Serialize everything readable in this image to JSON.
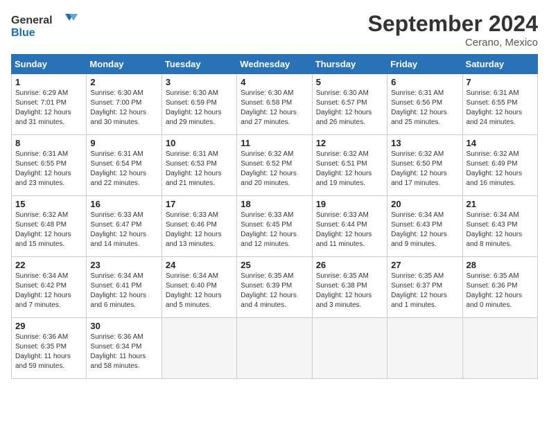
{
  "header": {
    "logo_general": "General",
    "logo_blue": "Blue",
    "title": "September 2024",
    "location": "Cerano, Mexico"
  },
  "weekdays": [
    "Sunday",
    "Monday",
    "Tuesday",
    "Wednesday",
    "Thursday",
    "Friday",
    "Saturday"
  ],
  "weeks": [
    [
      {
        "day": "1",
        "sunrise": "6:29 AM",
        "sunset": "7:01 PM",
        "daylight": "12 hours and 31 minutes."
      },
      {
        "day": "2",
        "sunrise": "6:30 AM",
        "sunset": "7:00 PM",
        "daylight": "12 hours and 30 minutes."
      },
      {
        "day": "3",
        "sunrise": "6:30 AM",
        "sunset": "6:59 PM",
        "daylight": "12 hours and 29 minutes."
      },
      {
        "day": "4",
        "sunrise": "6:30 AM",
        "sunset": "6:58 PM",
        "daylight": "12 hours and 27 minutes."
      },
      {
        "day": "5",
        "sunrise": "6:30 AM",
        "sunset": "6:57 PM",
        "daylight": "12 hours and 26 minutes."
      },
      {
        "day": "6",
        "sunrise": "6:31 AM",
        "sunset": "6:56 PM",
        "daylight": "12 hours and 25 minutes."
      },
      {
        "day": "7",
        "sunrise": "6:31 AM",
        "sunset": "6:55 PM",
        "daylight": "12 hours and 24 minutes."
      }
    ],
    [
      {
        "day": "8",
        "sunrise": "6:31 AM",
        "sunset": "6:55 PM",
        "daylight": "12 hours and 23 minutes."
      },
      {
        "day": "9",
        "sunrise": "6:31 AM",
        "sunset": "6:54 PM",
        "daylight": "12 hours and 22 minutes."
      },
      {
        "day": "10",
        "sunrise": "6:31 AM",
        "sunset": "6:53 PM",
        "daylight": "12 hours and 21 minutes."
      },
      {
        "day": "11",
        "sunrise": "6:32 AM",
        "sunset": "6:52 PM",
        "daylight": "12 hours and 20 minutes."
      },
      {
        "day": "12",
        "sunrise": "6:32 AM",
        "sunset": "6:51 PM",
        "daylight": "12 hours and 19 minutes."
      },
      {
        "day": "13",
        "sunrise": "6:32 AM",
        "sunset": "6:50 PM",
        "daylight": "12 hours and 17 minutes."
      },
      {
        "day": "14",
        "sunrise": "6:32 AM",
        "sunset": "6:49 PM",
        "daylight": "12 hours and 16 minutes."
      }
    ],
    [
      {
        "day": "15",
        "sunrise": "6:32 AM",
        "sunset": "6:48 PM",
        "daylight": "12 hours and 15 minutes."
      },
      {
        "day": "16",
        "sunrise": "6:33 AM",
        "sunset": "6:47 PM",
        "daylight": "12 hours and 14 minutes."
      },
      {
        "day": "17",
        "sunrise": "6:33 AM",
        "sunset": "6:46 PM",
        "daylight": "12 hours and 13 minutes."
      },
      {
        "day": "18",
        "sunrise": "6:33 AM",
        "sunset": "6:45 PM",
        "daylight": "12 hours and 12 minutes."
      },
      {
        "day": "19",
        "sunrise": "6:33 AM",
        "sunset": "6:44 PM",
        "daylight": "12 hours and 11 minutes."
      },
      {
        "day": "20",
        "sunrise": "6:34 AM",
        "sunset": "6:43 PM",
        "daylight": "12 hours and 9 minutes."
      },
      {
        "day": "21",
        "sunrise": "6:34 AM",
        "sunset": "6:43 PM",
        "daylight": "12 hours and 8 minutes."
      }
    ],
    [
      {
        "day": "22",
        "sunrise": "6:34 AM",
        "sunset": "6:42 PM",
        "daylight": "12 hours and 7 minutes."
      },
      {
        "day": "23",
        "sunrise": "6:34 AM",
        "sunset": "6:41 PM",
        "daylight": "12 hours and 6 minutes."
      },
      {
        "day": "24",
        "sunrise": "6:34 AM",
        "sunset": "6:40 PM",
        "daylight": "12 hours and 5 minutes."
      },
      {
        "day": "25",
        "sunrise": "6:35 AM",
        "sunset": "6:39 PM",
        "daylight": "12 hours and 4 minutes."
      },
      {
        "day": "26",
        "sunrise": "6:35 AM",
        "sunset": "6:38 PM",
        "daylight": "12 hours and 3 minutes."
      },
      {
        "day": "27",
        "sunrise": "6:35 AM",
        "sunset": "6:37 PM",
        "daylight": "12 hours and 1 minute."
      },
      {
        "day": "28",
        "sunrise": "6:35 AM",
        "sunset": "6:36 PM",
        "daylight": "12 hours and 0 minutes."
      }
    ],
    [
      {
        "day": "29",
        "sunrise": "6:36 AM",
        "sunset": "6:35 PM",
        "daylight": "11 hours and 59 minutes."
      },
      {
        "day": "30",
        "sunrise": "6:36 AM",
        "sunset": "6:34 PM",
        "daylight": "11 hours and 58 minutes."
      },
      null,
      null,
      null,
      null,
      null
    ]
  ]
}
